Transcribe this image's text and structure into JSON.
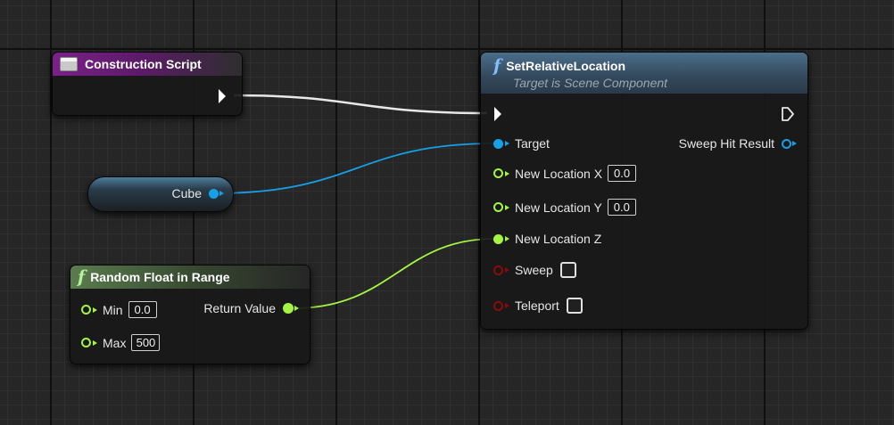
{
  "colors": {
    "object_pin": "#16a0e8",
    "float_pin": "#a4f542",
    "bool_pin": "#8b0a0a",
    "exec_wire": "#e8e8e8",
    "event_header": "#7b2089",
    "function_header_blue": "#4b6e8a",
    "function_header_green": "#5a7c4e"
  },
  "construction_node": {
    "title": "Construction Script",
    "icon": "event-icon"
  },
  "cube_node": {
    "label": "Cube"
  },
  "random_node": {
    "title": "Random Float in Range",
    "icon": "function-icon",
    "min_label": "Min",
    "min_value": "0.0",
    "max_label": "Max",
    "max_value": "500",
    "return_label": "Return Value"
  },
  "set_node": {
    "title": "SetRelativeLocation",
    "subtitle": "Target is Scene Component",
    "icon": "function-icon",
    "target_label": "Target",
    "sweep_hit_label": "Sweep Hit Result",
    "x_label": "New Location X",
    "x_value": "0.0",
    "y_label": "New Location Y",
    "y_value": "0.0",
    "z_label": "New Location Z",
    "sweep_label": "Sweep",
    "teleport_label": "Teleport"
  }
}
